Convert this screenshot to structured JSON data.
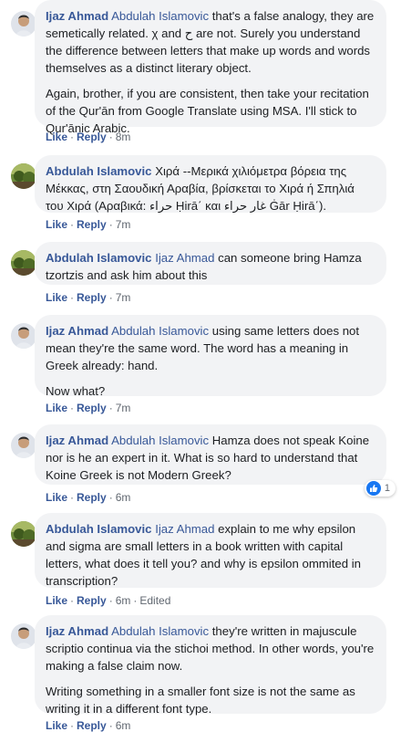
{
  "actions": {
    "like": "Like",
    "reply": "Reply",
    "separator": "·",
    "edited": "Edited"
  },
  "comments": [
    {
      "author": "Ijaz Ahmad",
      "mention": "Abdulah Islamovic",
      "paragraphs": [
        "that's a false analogy, they are semetically related. χ and ح are not. Surely you understand the difference between letters that make up words and words themselves as a distinct literary object.",
        "Again, brother, if you are consistent, then take your recitation of the Qur'ān from Google Translate using MSA. I'll stick to Qur'ānic Arabic."
      ],
      "time": "8m"
    },
    {
      "author": "Abdulah Islamovic",
      "mention": "",
      "paragraphs": [
        "Χιρά --Μερικά χιλιόμετρα βόρεια της Μέκκας, στη Σαουδική Αραβία, βρίσκεται το Χιρά ή Σπηλιά του Χιρά (Αραβικά: حراء Ḥirā΄ και غار حراء Ġār Ḥirā΄)."
      ],
      "time": "7m"
    },
    {
      "author": "Abdulah Islamovic",
      "mention": "Ijaz Ahmad",
      "paragraphs": [
        "can someone bring Hamza tzortzis and ask him about this"
      ],
      "time": "7m"
    },
    {
      "author": "Ijaz Ahmad",
      "mention": "Abdulah Islamovic",
      "paragraphs": [
        "using same letters does not mean they're the same word. The word has a meaning in Greek already: hand.",
        "Now what?"
      ],
      "time": "7m"
    },
    {
      "author": "Ijaz Ahmad",
      "mention": "Abdulah Islamovic",
      "paragraphs": [
        "Hamza does not speak Koine nor is he an expert in it. What is so hard to understand that Koine Greek is not Modern Greek?"
      ],
      "time": "6m",
      "reaction_count": "1"
    },
    {
      "author": "Abdulah Islamovic",
      "mention": "Ijaz Ahmad",
      "paragraphs": [
        "explain to me why epsilon and sigma are small letters in a book written with capital letters, what does it tell you? and why is epsilon ommited in transcription?"
      ],
      "time": "6m",
      "edited": true
    },
    {
      "author": "Ijaz Ahmad",
      "mention": "Abdulah Islamovic",
      "paragraphs": [
        "they're written in majuscule scriptio continua via the stichoi method. In other words, you're making a false claim now.",
        "Writing something in a smaller font size is not the same as writing it in a different font type."
      ],
      "time": "6m"
    }
  ],
  "colors": {
    "link": "#385898",
    "bubble": "#f2f3f5",
    "meta": "#606770",
    "like_blue": "#1877f2"
  }
}
